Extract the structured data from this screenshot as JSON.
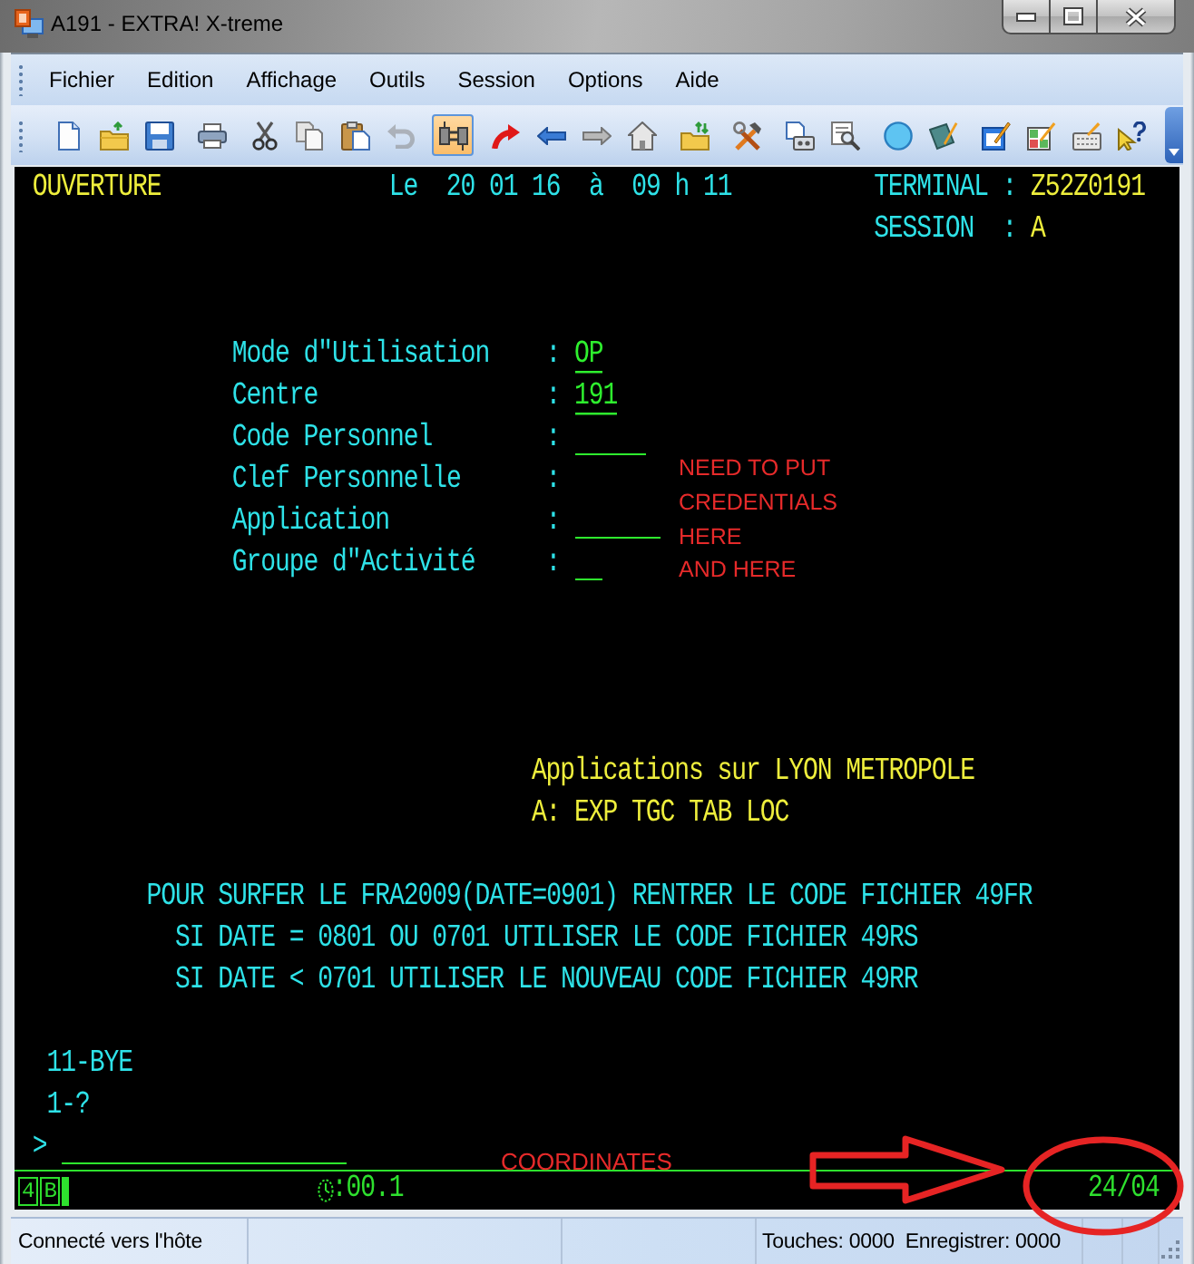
{
  "window": {
    "title": "A191 - EXTRA! X-treme"
  },
  "menu": [
    "Fichier",
    "Edition",
    "Affichage",
    "Outils",
    "Session",
    "Options",
    "Aide"
  ],
  "toolbar": [
    {
      "kind": "new",
      "selected": false,
      "disabled": false
    },
    {
      "kind": "open",
      "selected": false,
      "disabled": false
    },
    {
      "kind": "save",
      "selected": false,
      "disabled": false
    },
    {
      "kind": "print",
      "selected": false,
      "disabled": false
    },
    {
      "kind": "cut",
      "selected": false,
      "disabled": false
    },
    {
      "kind": "copy",
      "selected": false,
      "disabled": false
    },
    {
      "kind": "paste",
      "selected": false,
      "disabled": false
    },
    {
      "kind": "undo",
      "selected": false,
      "disabled": true
    },
    {
      "kind": "connect",
      "selected": true,
      "disabled": false
    },
    {
      "kind": "send",
      "selected": false,
      "disabled": false
    },
    {
      "kind": "back",
      "selected": false,
      "disabled": false
    },
    {
      "kind": "forward",
      "selected": false,
      "disabled": false
    },
    {
      "kind": "home",
      "selected": false,
      "disabled": false
    },
    {
      "kind": "transfer",
      "selected": false,
      "disabled": false
    },
    {
      "kind": "tools",
      "selected": false,
      "disabled": false
    },
    {
      "kind": "tape",
      "selected": false,
      "disabled": false
    },
    {
      "kind": "inspect",
      "selected": false,
      "disabled": false
    },
    {
      "kind": "record",
      "selected": false,
      "disabled": false
    },
    {
      "kind": "notes",
      "selected": false,
      "disabled": false
    },
    {
      "kind": "window",
      "selected": false,
      "disabled": false
    },
    {
      "kind": "grid",
      "selected": false,
      "disabled": false
    },
    {
      "kind": "keyboard",
      "selected": false,
      "disabled": false
    },
    {
      "kind": "help",
      "selected": false,
      "disabled": false
    }
  ],
  "terminal": {
    "screen_title": "OUVERTURE",
    "datetime": "Le  20 01 16  à  09 h 11",
    "terminal_id": {
      "label": "TERMINAL",
      "separator": ":",
      "value": "Z52Z0191"
    },
    "session": {
      "label": "SESSION",
      "separator": ":",
      "value": "A"
    },
    "fields": [
      {
        "label": "Mode d\"Utilisation",
        "separator": ":",
        "kind": "filled",
        "value": "OP"
      },
      {
        "label": "Centre",
        "separator": ":",
        "kind": "filled",
        "value": "191"
      },
      {
        "label": "Code Personnel",
        "separator": ":",
        "kind": "blank"
      },
      {
        "label": "Clef Personnelle",
        "separator": ":",
        "kind": "hidden"
      },
      {
        "label": "Application",
        "separator": ":",
        "kind": "blank"
      },
      {
        "label": "Groupe d\"Activité",
        "separator": ":",
        "kind": "blank"
      }
    ],
    "applications": {
      "title": "Applications sur LYON METROPOLE",
      "list": "A: EXP TGC TAB LOC"
    },
    "notices": [
      "POUR SURFER LE FRA2009(DATE=0901) RENTRER LE CODE FICHIER 49FR",
      "SI DATE = 0801 OU 0701 UTILISER LE CODE FICHIER 49RS",
      "SI DATE < 0701 UTILISER LE NOUVEAU CODE FICHIER 49RR"
    ],
    "options": [
      "11-BYE",
      "1-?"
    ],
    "command_line": {
      "prompt": ">"
    },
    "operator_info": {
      "indicators": [
        "4",
        "B"
      ],
      "timer": ":00.1",
      "cursor_position": "24/04"
    }
  },
  "annotations": {
    "credentials_note": [
      "NEED TO PUT",
      "CREDENTIALS",
      "HERE",
      "AND HERE"
    ],
    "coordinates_note": "COORDINATES"
  },
  "status_bar": {
    "connection": "Connecté vers l'hôte",
    "keystrokes": "Touches: 0000",
    "recording": "Enregistrer: 0000"
  }
}
